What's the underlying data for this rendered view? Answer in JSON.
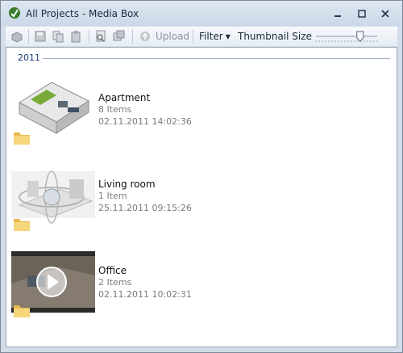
{
  "window": {
    "title": "All Projects - Media Box"
  },
  "toolbar": {
    "upload_label": "Upload",
    "filter_label": "Filter",
    "thumbnail_size_label": "Thumbnail Size",
    "thumbnail_size_level": 0.72
  },
  "group": {
    "year": "2011"
  },
  "items": [
    {
      "name": "Apartment",
      "count": "8 Items",
      "date": "02.11.2011 14:02:36",
      "thumb": "apartment-3d-floorplan"
    },
    {
      "name": "Living room",
      "count": "1 Item",
      "date": "25.11.2011 09:15:26",
      "thumb": "living-room-panorama"
    },
    {
      "name": "Office",
      "count": "2 Items",
      "date": "02.11.2011 10:02:31",
      "thumb": "office-video"
    }
  ],
  "colors": {
    "title_bg": "#d3ddea",
    "accent_line": "#9bb0c9",
    "folder": "#f2c94c"
  }
}
